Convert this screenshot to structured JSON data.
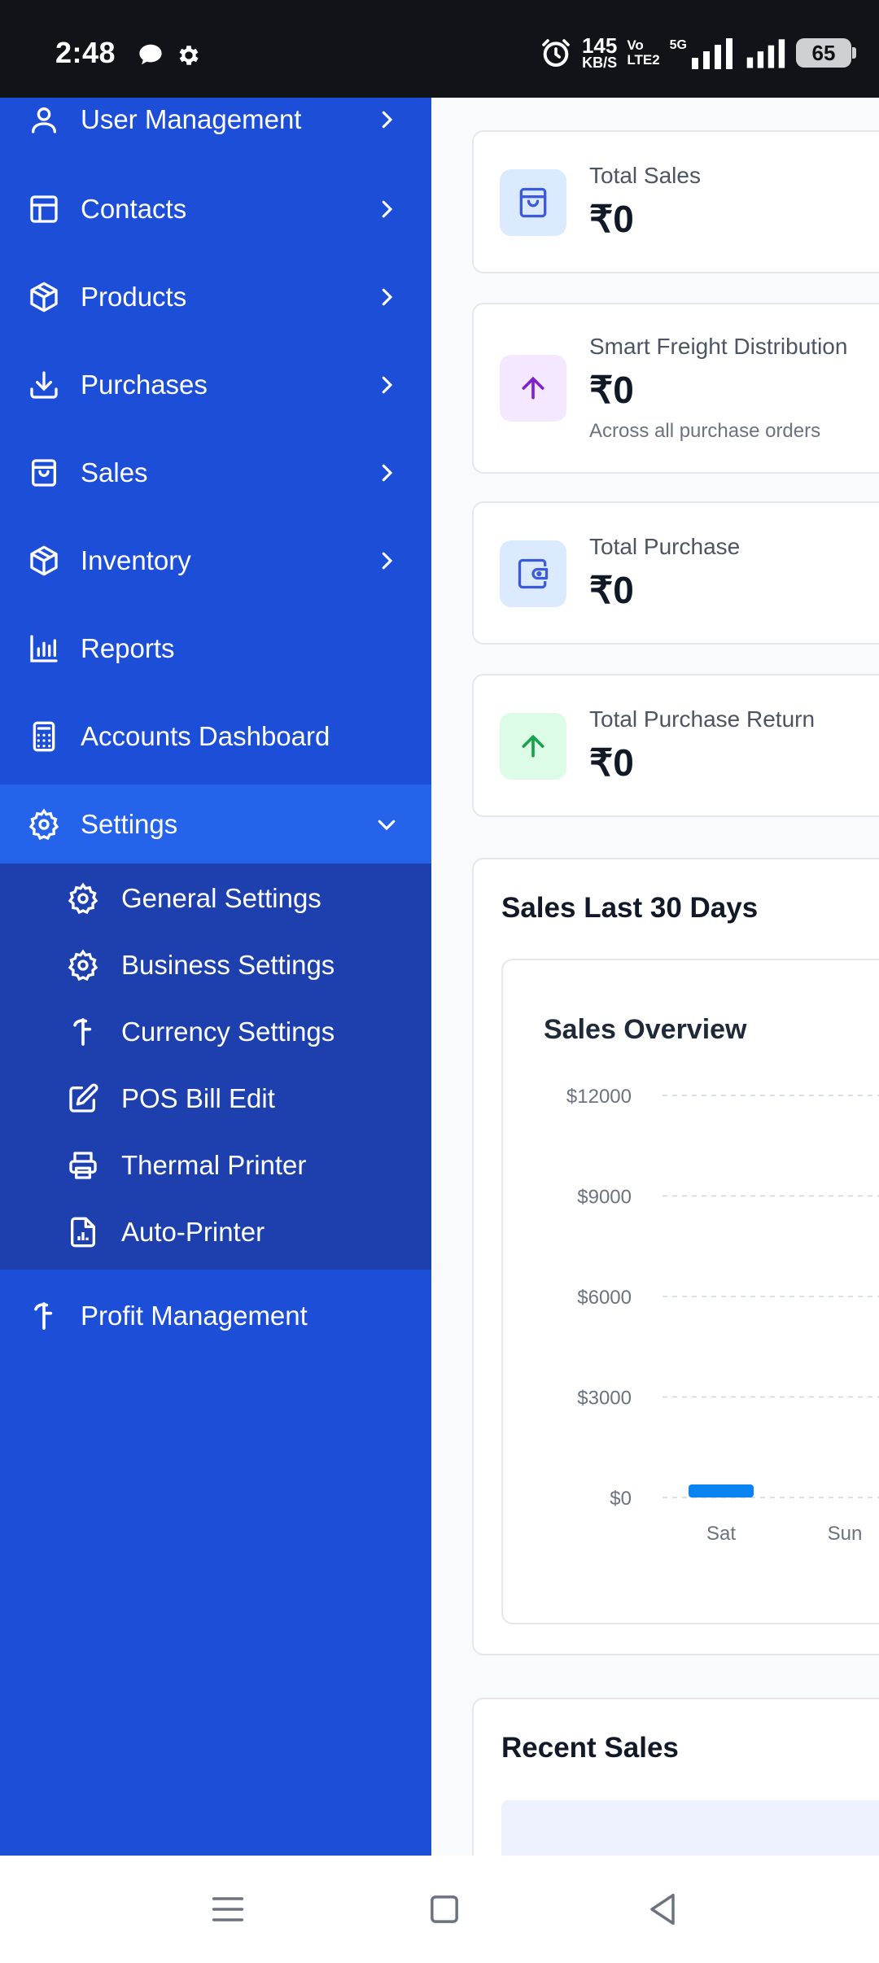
{
  "status_bar": {
    "time": "2:48",
    "speed_value": "145",
    "speed_unit": "KB/S",
    "volte_line1": "Vo",
    "volte_line2": "LTE2",
    "network": "5G",
    "battery": "65"
  },
  "sidebar": {
    "items": [
      {
        "label": "User Management",
        "icon": "user-icon"
      },
      {
        "label": "Contacts",
        "icon": "layout-icon"
      },
      {
        "label": "Products",
        "icon": "box-icon"
      },
      {
        "label": "Purchases",
        "icon": "download-icon"
      },
      {
        "label": "Sales",
        "icon": "shopping-bag-icon"
      },
      {
        "label": "Inventory",
        "icon": "box-icon"
      },
      {
        "label": "Reports",
        "icon": "bar-chart-icon"
      },
      {
        "label": "Accounts Dashboard",
        "icon": "calculator-icon"
      },
      {
        "label": "Settings",
        "icon": "gear-icon"
      },
      {
        "label": "Profit Management",
        "icon": "currency-icon"
      }
    ],
    "settings_submenu": [
      {
        "label": "General Settings",
        "icon": "gear-icon"
      },
      {
        "label": "Business Settings",
        "icon": "gear-icon"
      },
      {
        "label": "Currency Settings",
        "icon": "currency-icon"
      },
      {
        "label": "POS Bill Edit",
        "icon": "edit-icon"
      },
      {
        "label": "Thermal Printer",
        "icon": "printer-icon"
      },
      {
        "label": "Auto-Printer",
        "icon": "file-chart-icon"
      }
    ]
  },
  "stats": [
    {
      "title": "Total Sales",
      "value": "₹0",
      "icon": "shopping-bag-icon",
      "color": "#dbeafe"
    },
    {
      "title": "Smart Freight Distribution",
      "value": "₹0",
      "sub": "Across all purchase orders",
      "icon": "arrow-up-icon",
      "color": "#f3e8ff"
    },
    {
      "title": "Total Purchase",
      "value": "₹0",
      "icon": "wallet-icon",
      "color": "#dbeafe"
    },
    {
      "title": "Total Purchase Return",
      "value": "₹0",
      "icon": "arrow-up-icon",
      "color": "#dcfce7"
    }
  ],
  "sales_section": {
    "title": "Sales Last 30 Days",
    "chart_title": "Sales Overview"
  },
  "chart_data": {
    "type": "bar",
    "title": "Sales Overview",
    "xlabel": "",
    "ylabel": "",
    "categories": [
      "Sat",
      "Sun"
    ],
    "values": [
      0,
      0
    ],
    "ylim": [
      0,
      12000
    ],
    "y_ticks": [
      "$12000",
      "$9000",
      "$6000",
      "$3000",
      "$0"
    ],
    "grid": true,
    "bar_color": "#0b84f3"
  },
  "recent_sales": {
    "title": "Recent Sales"
  },
  "colors": {
    "sidebar": "#1d4ed8",
    "sidebar_active": "#2563eb",
    "submenu": "#1e40af"
  }
}
